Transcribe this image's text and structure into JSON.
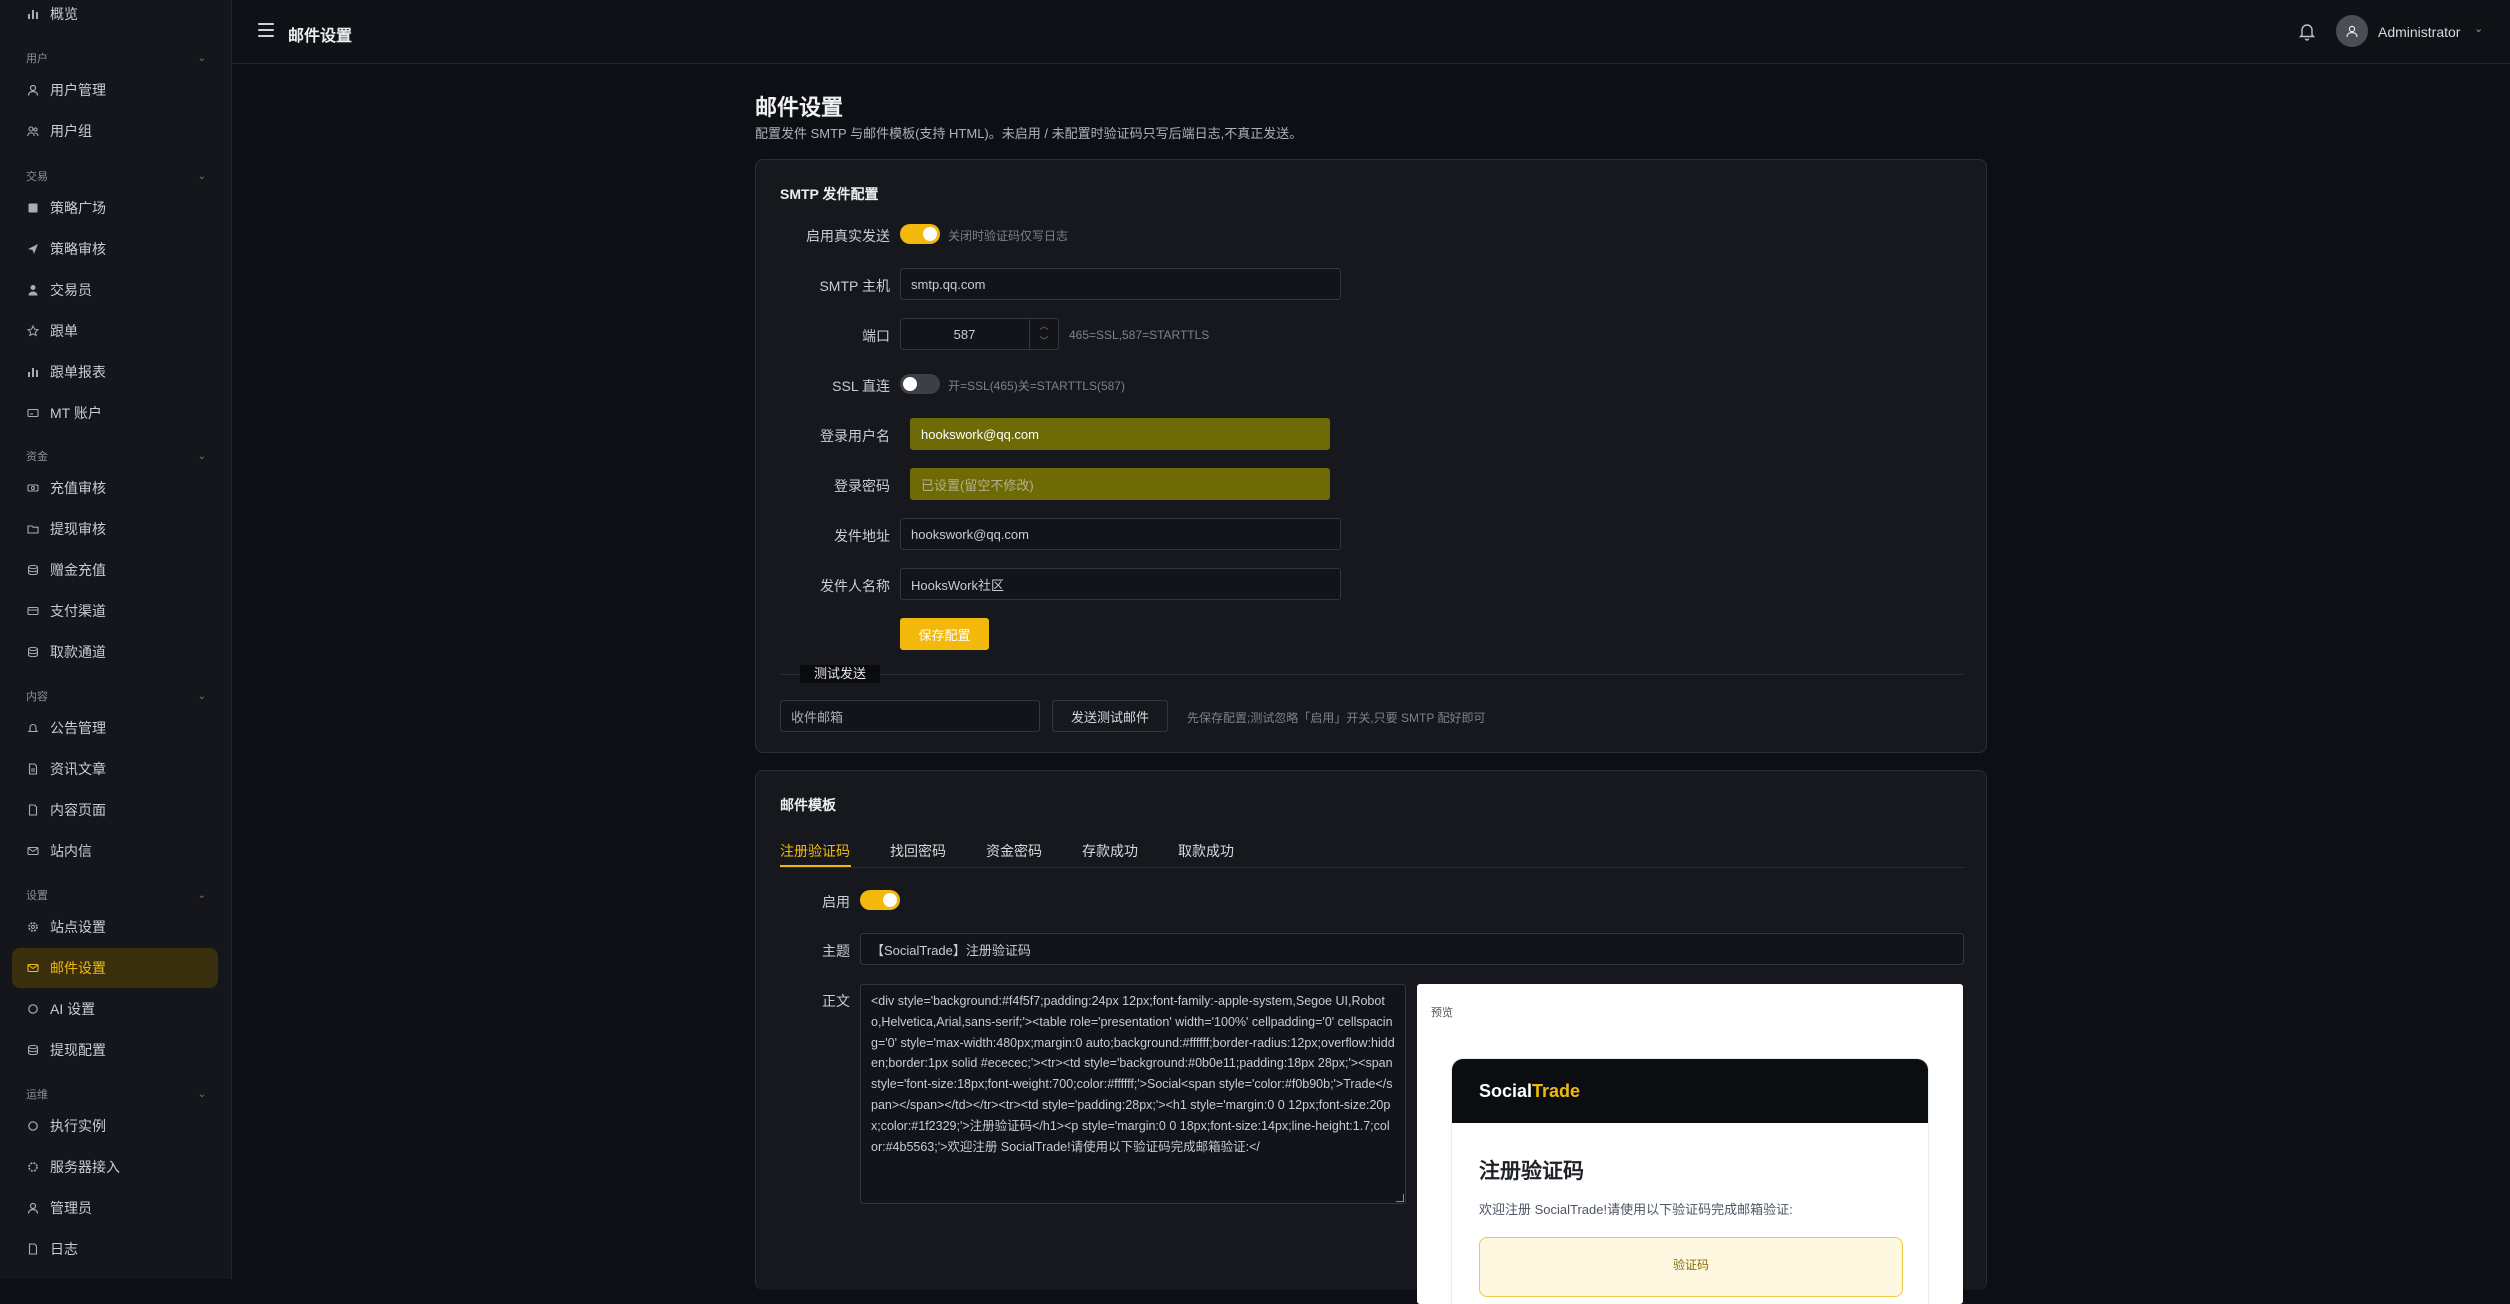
{
  "sidebar": {
    "overview": "概览",
    "groups": [
      {
        "label": "用户",
        "items": [
          "用户管理",
          "用户组"
        ]
      },
      {
        "label": "交易",
        "items": [
          "策略广场",
          "策略审核",
          "交易员",
          "跟单",
          "跟单报表",
          "MT 账户"
        ]
      },
      {
        "label": "资金",
        "items": [
          "充值审核",
          "提现审核",
          "赠金充值",
          "支付渠道",
          "取款通道"
        ]
      },
      {
        "label": "内容",
        "items": [
          "公告管理",
          "资讯文章",
          "内容页面",
          "站内信"
        ]
      },
      {
        "label": "设置",
        "items": [
          "站点设置",
          "邮件设置",
          "AI 设置",
          "提现配置"
        ]
      },
      {
        "label": "运维",
        "items": [
          "执行实例",
          "服务器接入",
          "管理员",
          "日志"
        ]
      }
    ],
    "active_item": "邮件设置"
  },
  "topbar": {
    "title": "邮件设置",
    "user_name": "Administrator"
  },
  "page": {
    "title": "邮件设置",
    "subtitle": "配置发件 SMTP 与邮件模板(支持 HTML)。未启用 / 未配置时验证码只写后端日志,不真正发送。"
  },
  "smtp": {
    "title": "SMTP 发件配置",
    "enable_label": "启用真实发送",
    "enable_hint": "关闭时验证码仅写日志",
    "host_label": "SMTP 主机",
    "host_value": "smtp.qq.com",
    "port_label": "端口",
    "port_value": "587",
    "port_hint": "465=SSL,587=STARTTLS",
    "ssl_label": "SSL 直连",
    "ssl_hint": "开=SSL(465)关=STARTTLS(587)",
    "user_label": "登录用户名",
    "user_value": "hookswork@qq.com",
    "password_label": "登录密码",
    "password_placeholder": "已设置(留空不修改)",
    "from_label": "发件地址",
    "from_value": "hookswork@qq.com",
    "sender_label": "发件人名称",
    "sender_value": "HooksWork社区",
    "save_label": "保存配置",
    "test_divider": "测试发送",
    "recipient_placeholder": "收件邮箱",
    "send_test_label": "发送测试邮件",
    "test_hint": "先保存配置;测试忽略「启用」开关,只要 SMTP 配好即可"
  },
  "templates": {
    "title": "邮件模板",
    "tabs": [
      "注册验证码",
      "找回密码",
      "资金密码",
      "存款成功",
      "取款成功"
    ],
    "active_tab": "注册验证码",
    "enabled_label": "启用",
    "subject_label": "主题",
    "subject_value": "【SocialTrade】注册验证码",
    "body_label": "正文",
    "body_value": "<div style='background:#f4f5f7;padding:24px 12px;font-family:-apple-system,Segoe UI,Roboto,Helvetica,Arial,sans-serif;'><table role='presentation' width='100%' cellpadding='0' cellspacing='0' style='max-width:480px;margin:0 auto;background:#ffffff;border-radius:12px;overflow:hidden;border:1px solid #ececec;'><tr><td style='background:#0b0e11;padding:18px 28px;'><span style='font-size:18px;font-weight:700;color:#ffffff;'>Social<span style='color:#f0b90b;'>Trade</span></span></td></tr><tr><td style='padding:28px;'><h1 style='margin:0 0 12px;font-size:20px;color:#1f2329;'>注册验证码</h1><p style='margin:0 0 18px;font-size:14px;line-height:1.7;color:#4b5563;'>欢迎注册 SocialTrade!请使用以下验证码完成邮箱验证:</",
    "preview_label": "预览",
    "preview": {
      "brand_a": "Social",
      "brand_b": "Trade",
      "heading": "注册验证码",
      "text": "欢迎注册 SocialTrade!请使用以下验证码完成邮箱验证:",
      "code_label": "验证码"
    }
  },
  "colors": {
    "accent": "#f2b90c",
    "background": "#0d0f14",
    "sidebar": "#14161c",
    "card": "#16181e"
  }
}
